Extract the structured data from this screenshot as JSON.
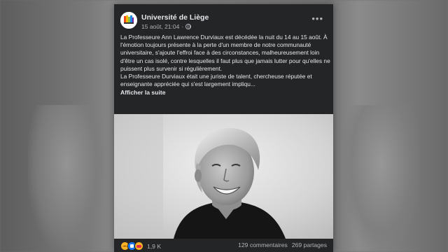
{
  "post": {
    "page_name": "Université de Liège",
    "timestamp": "15 août, 21:04",
    "visibility_icon": "globe-icon",
    "more_icon": "more-options-icon",
    "paragraph_1": "La Professeure Ann Lawrence Durviaux est décédée la nuit du 14 au 15 août. À l'émotion toujours présente à la perte d'un membre de notre communauté universitaire, s'ajoute l'effroi face à des circonstances, malheureusement loin d'être un cas isolé, contre lesquelles il faut plus que jamais lutter pour qu'elles ne puissent plus survenir si régulièrement.",
    "paragraph_2": "La Professeure Durviaux était une juriste de talent, chercheuse réputée et enseignante appréciée qui s'est largement impliqu...",
    "see_more": "Afficher la suite",
    "photo_icon": "black-and-white-portrait-photo"
  },
  "footer": {
    "reactions": [
      "sad",
      "like",
      "care"
    ],
    "reaction_count": "1,9 K",
    "comments": "129 commentaires",
    "shares": "269 partages"
  },
  "colors": {
    "card_bg": "#242526",
    "text_primary": "#e4e6eb",
    "text_secondary": "#b0b3b8",
    "like_blue": "#1877f2"
  }
}
